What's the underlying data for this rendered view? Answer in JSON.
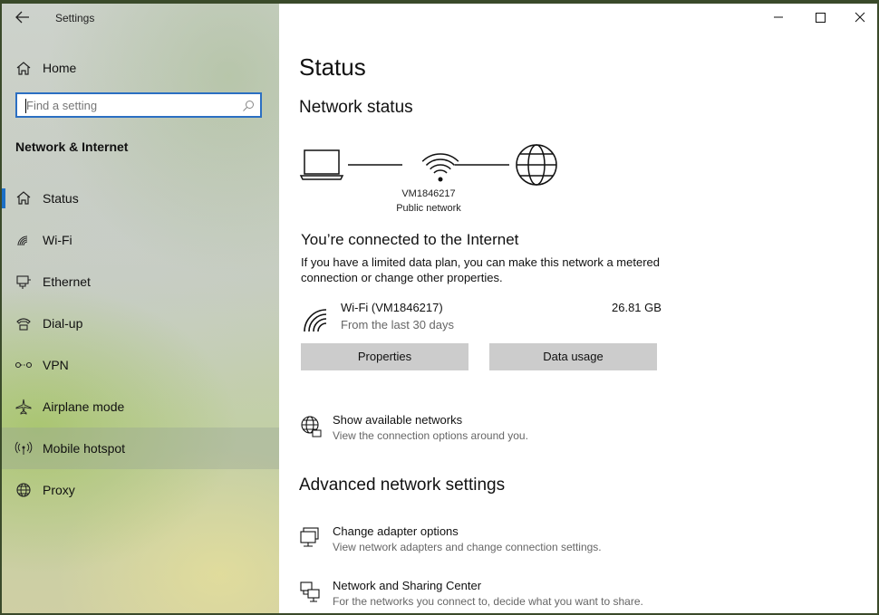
{
  "window": {
    "app_title": "Settings"
  },
  "sidebar": {
    "home_label": "Home",
    "search_placeholder": "Find a setting",
    "section_title": "Network & Internet",
    "items": [
      {
        "label": "Status",
        "icon": "home-status-icon"
      },
      {
        "label": "Wi-Fi",
        "icon": "wifi-icon"
      },
      {
        "label": "Ethernet",
        "icon": "ethernet-icon"
      },
      {
        "label": "Dial-up",
        "icon": "dialup-icon"
      },
      {
        "label": "VPN",
        "icon": "vpn-icon"
      },
      {
        "label": "Airplane mode",
        "icon": "airplane-icon"
      },
      {
        "label": "Mobile hotspot",
        "icon": "hotspot-icon"
      },
      {
        "label": "Proxy",
        "icon": "globe-icon"
      }
    ],
    "selected": "Status"
  },
  "main": {
    "title": "Status",
    "network_status_heading": "Network status",
    "network_name": "VM1846217",
    "network_type": "Public network",
    "connected_heading": "You’re connected to the Internet",
    "connected_desc": "If you have a limited data plan, you can make this network a metered connection or change other properties.",
    "wifi_name": "Wi-Fi (VM1846217)",
    "wifi_sub": "From the last 30 days",
    "wifi_usage": "26.81 GB",
    "properties_label": "Properties",
    "data_usage_label": "Data usage",
    "show_networks_title": "Show available networks",
    "show_networks_desc": "View the connection options around you.",
    "advanced_heading": "Advanced network settings",
    "adapter_title": "Change adapter options",
    "adapter_desc": "View network adapters and change connection settings.",
    "sharing_title": "Network and Sharing Center",
    "sharing_desc": "For the networks you connect to, decide what you want to share."
  },
  "colors": {
    "accent": "#1c6fc6",
    "button_bg": "#cccccc"
  }
}
